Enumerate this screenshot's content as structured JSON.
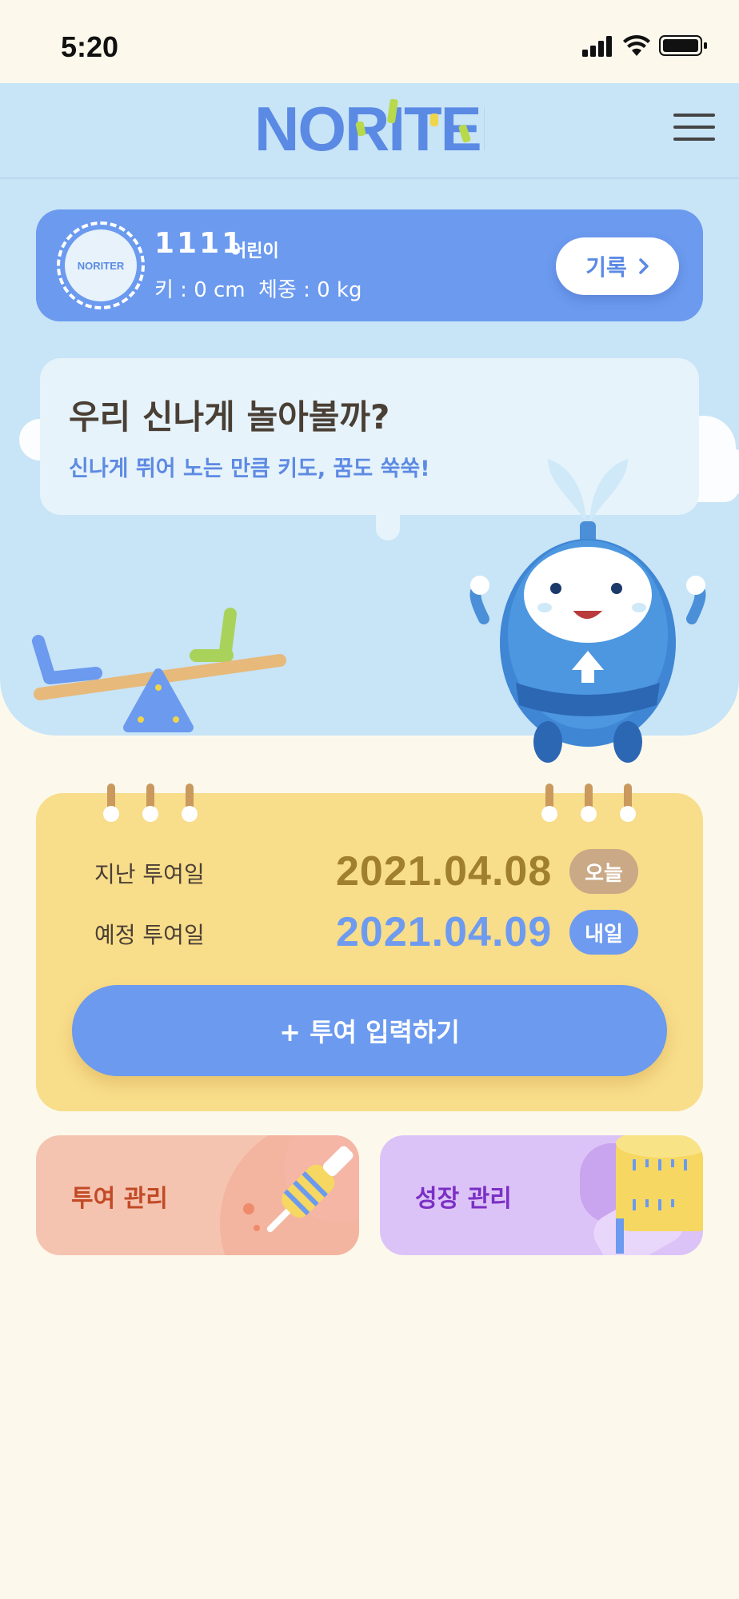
{
  "status_bar": {
    "time": "5:20",
    "icons": [
      "signal-icon",
      "wifi-icon",
      "battery-icon"
    ]
  },
  "header": {
    "logo_text": "NORITER",
    "menu_icon": "hamburger-menu-icon"
  },
  "profile": {
    "name": "1111",
    "suffix": "어린이",
    "height": "키 : 0 cm",
    "weight": "체중 : 0 kg",
    "record_button": "기록",
    "avatar_text": "NORITER"
  },
  "banner": {
    "title": "우리 신나게 놀아볼까?",
    "subtitle": "신나게 뛰어 노는 만큼 키도, 꿈도 쑥쑥!"
  },
  "schedule": {
    "last": {
      "label": "지난 투여일",
      "date": "2021.04.08",
      "badge": "오늘"
    },
    "next": {
      "label": "예정 투여일",
      "date": "2021.04.09",
      "badge": "내일"
    },
    "add_button": "+ 투여 입력하기"
  },
  "menu_cards": {
    "dose": "투여 관리",
    "growth": "성장 관리"
  },
  "colors": {
    "background": "#fcf9ec",
    "hero": "#c8e4f7",
    "primary": "#6b9aef",
    "calendar": "#f8dd8a",
    "dose_card": "#f5c4b0",
    "growth_card": "#dcc3f7"
  }
}
